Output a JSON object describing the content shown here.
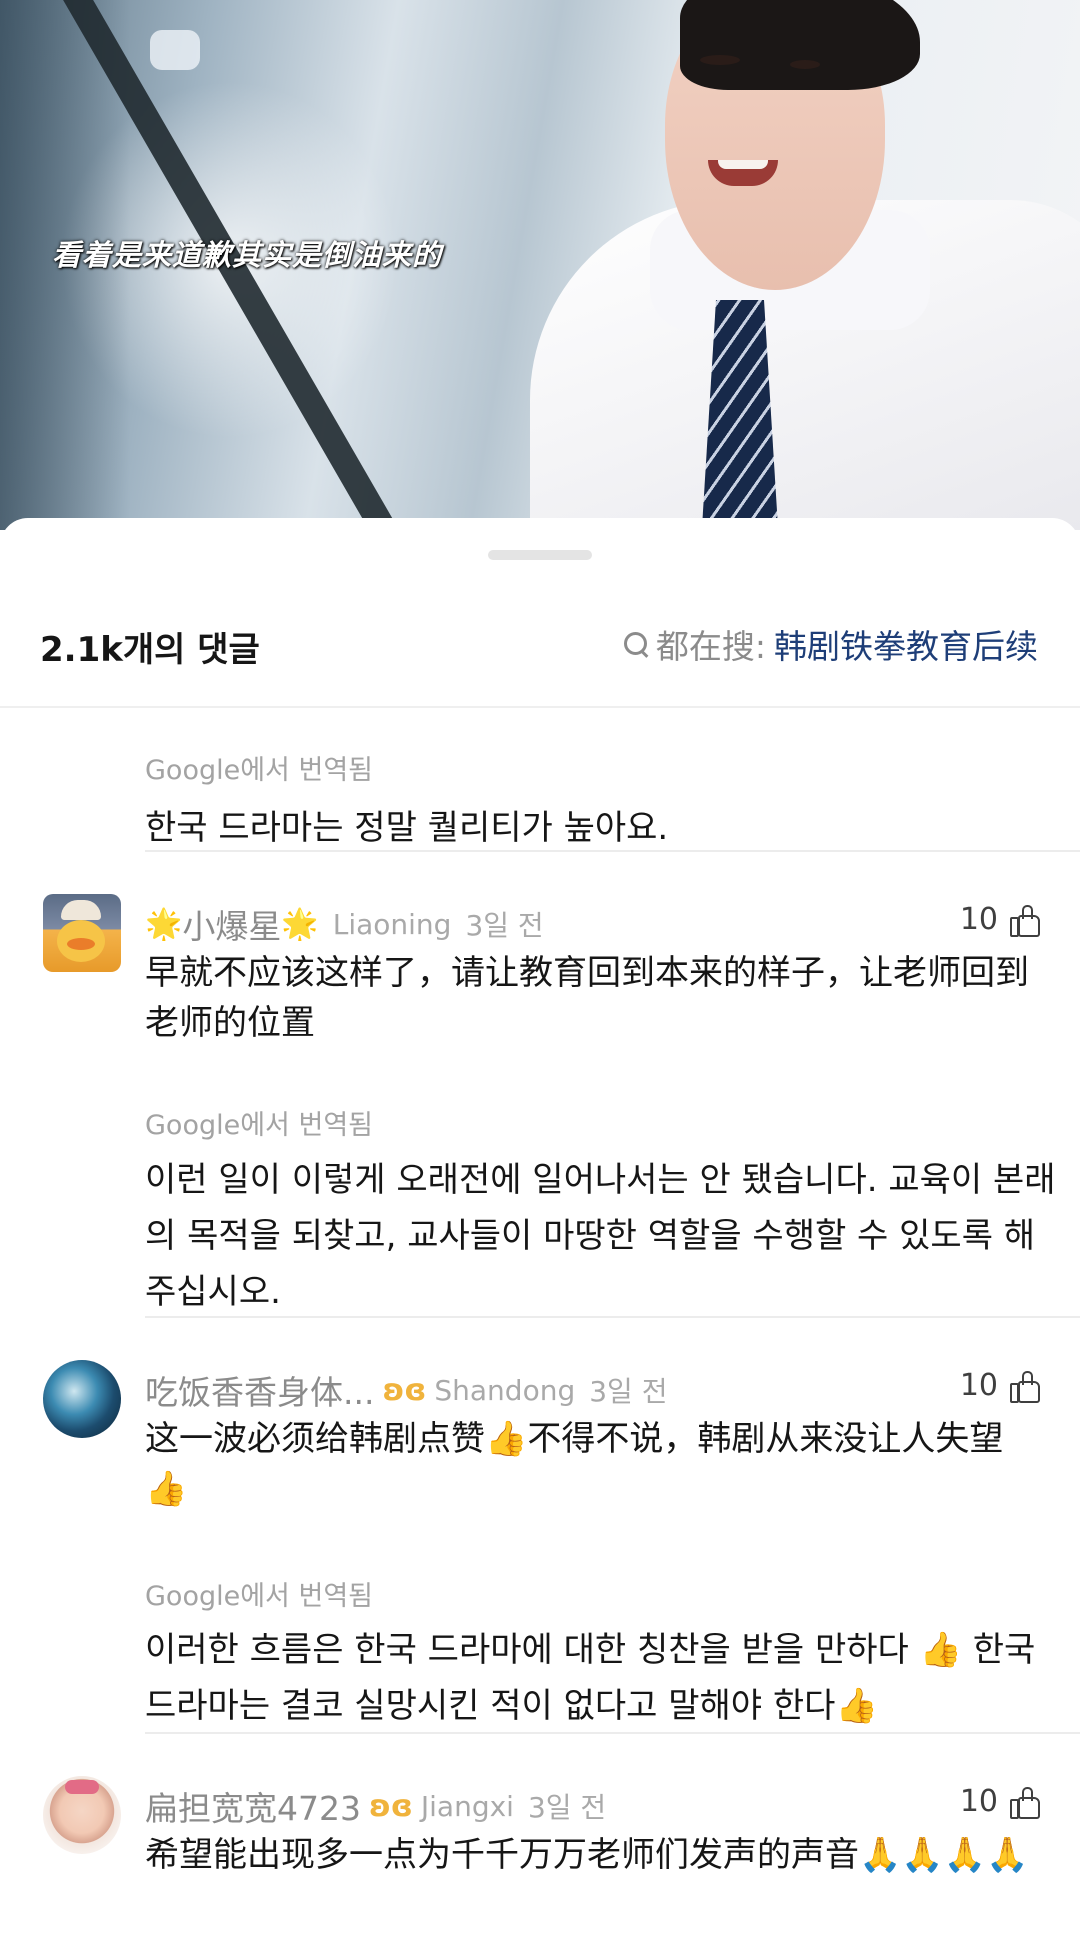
{
  "video": {
    "subtitle": "看着是来道歉其实是倒油来的"
  },
  "header": {
    "comment_count": "2.1k개의 댓글",
    "search_prefix": "都在搜:",
    "search_term": "韩剧铁拳教育后续"
  },
  "translation_label": "Google에서 번역됨",
  "top_translation": "한국 드라마는 정말 퀄리티가 높아요.",
  "comments": [
    {
      "username": "小爆星",
      "username_decoration": "🌟",
      "location": "Liaoning",
      "time": "3일 전",
      "likes": "10",
      "text": "早就不应该这样了，请让教育回到本来的样子，让老师回到老师的位置",
      "translation": "이런 일이 이렇게 오래전에 일어나서는 안 됐습니다. 교육이 본래의 목적을 되찾고, 교사들이 마땅한 역할을 수행할 수 있도록 해주십시오."
    },
    {
      "username": "吃饭香香身体...",
      "badge": "ʚɞ",
      "location": "Shandong",
      "time": "3일 전",
      "likes": "10",
      "text": "这一波必须给韩剧点赞👍不得不说，韩剧从来没让人失望👍",
      "translation": "이러한 흐름은 한국 드라마에 대한 칭찬을 받을 만하다 👍 한국 드라마는 결코 실망시킨 적이 없다고 말해야 한다👍"
    },
    {
      "username": "扁担宽宽4723",
      "badge": "ʚɞ",
      "location": "Jiangxi",
      "time": "3일 전",
      "likes": "10",
      "text": "希望能出现多一点为千千万万老师们发声的声音🙏🙏🙏🙏"
    }
  ],
  "icons": {
    "search": "search-icon",
    "like": "thumbs-up-icon"
  }
}
